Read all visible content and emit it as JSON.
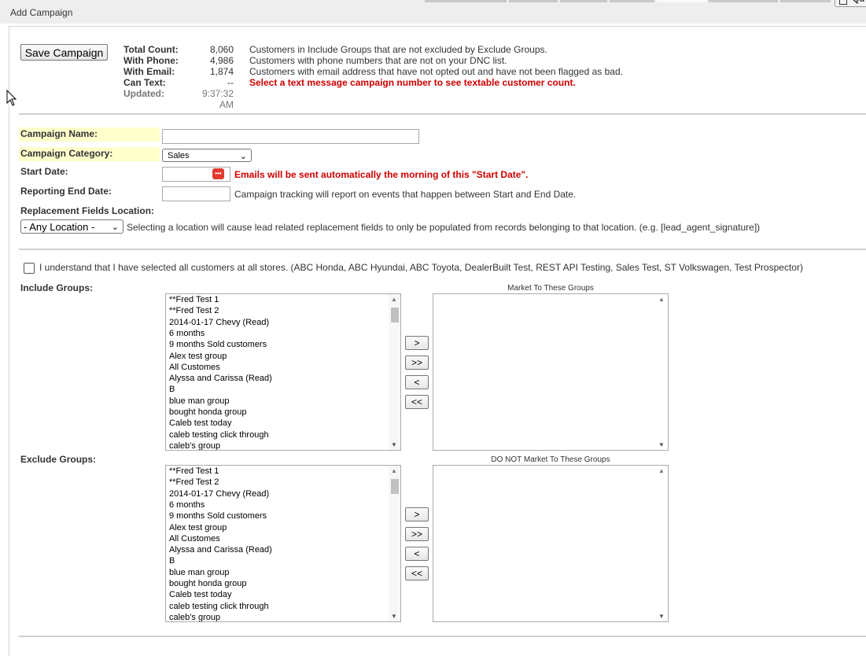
{
  "header": {
    "title": "Add Campaign",
    "quick_button_label": "Qu"
  },
  "actions": {
    "save_label": "Save Campaign"
  },
  "stats": {
    "total_label": "Total Count:",
    "total_value": "8,060",
    "total_desc": "Customers in Include Groups that are not excluded by Exclude Groups.",
    "phone_label": "With Phone:",
    "phone_value": "4,986",
    "phone_desc": "Customers with phone numbers that are not on your DNC list.",
    "email_label": "With Email:",
    "email_value": "1,874",
    "email_desc": "Customers with email address that have not opted out and have not been flagged as bad.",
    "text_label": "Can Text:",
    "text_value": "--",
    "text_desc": "Select a text message campaign number to see textable customer count.",
    "updated_label": "Updated:",
    "updated_value": "9:37:32 AM"
  },
  "form": {
    "name_label": "Campaign Name:",
    "name_value": "",
    "category_label": "Campaign Category:",
    "category_value": "Sales",
    "start_label": "Start Date:",
    "start_value": "",
    "start_note": "Emails will be sent automatically the morning of this \"Start Date\".",
    "end_label": "Reporting End Date:",
    "end_value": "",
    "end_note": "Campaign tracking will report on events that happen between Start and End Date.",
    "location_label": "Replacement Fields Location:",
    "location_value": "- Any Location -",
    "location_note": "Selecting a location will cause lead related replacement fields to only be populated from records belonging to that location. (e.g. [lead_agent_signature])"
  },
  "consent": {
    "label": "I understand that I have selected all customers at all stores. (ABC Honda, ABC Hyundai, ABC Toyota, DealerBuilt Test, REST API Testing, Sales Test, ST Volkswagen, Test Prospector)"
  },
  "include": {
    "label": "Include Groups:",
    "target_label": "Market To These Groups"
  },
  "exclude": {
    "label": "Exclude Groups:",
    "target_label": "DO NOT Market To These Groups"
  },
  "transfer_buttons": [
    ">",
    ">>",
    "<",
    "<<"
  ],
  "groups": [
    "**Fred Test 1",
    "**Fred Test 2",
    "2014-01-17 Chevy (Read)",
    "6 months",
    "9 months Sold customers",
    "Alex test group",
    "All Customes",
    "Alyssa and Carissa (Read)",
    "B",
    "blue man group",
    "bought honda group",
    "Caleb test today",
    "caleb testing click through",
    "caleb's group"
  ],
  "colors": {
    "highlight": "#ffffcc",
    "alert_red": "#d00000"
  }
}
